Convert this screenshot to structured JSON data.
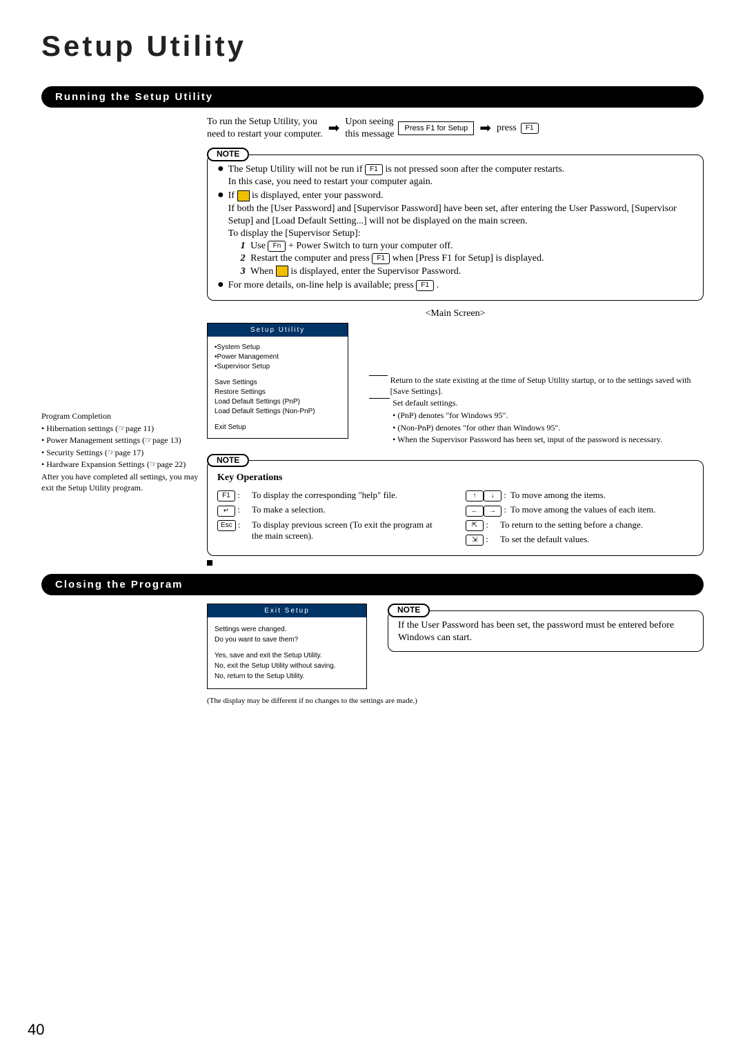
{
  "pageTitle": "Setup Utility",
  "pageNumber": "40",
  "section1": {
    "header": "Running the Setup Utility",
    "flow": {
      "text1a": "To run the Setup Utility, you",
      "text1b": "need to restart your computer.",
      "text2a": "Upon seeing",
      "text2b": "this message",
      "msgBox": "Press F1 for Setup",
      "text3": "press",
      "keyLabel": "F1"
    },
    "note1": {
      "label": "NOTE",
      "b1a": "The Setup Utility will not be run if ",
      "b1b": " is not pressed soon after the computer restarts.",
      "b1c": "In this case, you need to restart your computer again.",
      "f1": "F1",
      "b2a": "If ",
      "b2b": " is displayed, enter your password.",
      "b2c": "If both the [User Password] and [Supervisor Password] have been set, after entering the User Password, [Supervisor Setup] and [Load Default Setting...] will not be displayed on the main screen.",
      "b2d": "To display the [Supervisor Setup]:",
      "s1n": "1",
      "s1": "Use ",
      "s1k": "Fn",
      "s1b": " + Power Switch to turn your computer off.",
      "s2n": "2",
      "s2": "Restart the computer and press ",
      "s2k": "F1",
      "s2b": " when [Press F1 for Setup] is displayed.",
      "s3n": "3",
      "s3": "When ",
      "s3b": " is displayed, enter the Supervisor Password.",
      "b3a": "For more details, on-line help is available; press ",
      "b3k": "F1",
      "b3b": "."
    },
    "mainScreenLabel": "<Main Screen>",
    "screen": {
      "title": "Setup Utility",
      "items1": [
        "•System Setup",
        "•Power Management",
        "•Supervisor Setup"
      ],
      "items2": [
        "Save Settings",
        "Restore Settings",
        "Load Default Settings (PnP)",
        "Load Default Settings (Non-PnP)"
      ],
      "items3": [
        "Exit Setup"
      ]
    },
    "annotations": {
      "a1": "Return to the state existing at the time of Setup Utility startup, or to the settings saved with [Save Settings].",
      "a2": "Set default settings.",
      "a3": "• (PnP) denotes \"for Windows 95\".",
      "a4": "• (Non-PnP) denotes \"for other than Windows 95\".",
      "a5": "• When the Supervisor Password has been set, input of the password is necessary."
    },
    "sidebar": {
      "title": "Program Completion",
      "l1": "• Hibernation settings (",
      "p1": "page 11)",
      "l2": "• Power Management settings (",
      "p2": "page 13)",
      "l3": "• Security Settings (",
      "p3": "page 17)",
      "l4": "• Hardware Expansion Settings (",
      "p4": "page 22)",
      "l5": "After you have completed all settings, you may exit the Setup Utility program."
    },
    "note2": {
      "label": "NOTE",
      "title": "Key Operations",
      "k1": "F1",
      "d1": "To display the corresponding \"help\" file.",
      "k2": "Enter",
      "d2": "To make a selection.",
      "k3": "Esc",
      "d3": "To display previous screen (To exit the program at the main screen).",
      "k4a": "↑",
      "k4b": "↓",
      "d4": "To move among the items.",
      "k5a": "←",
      "k5b": "→",
      "d5": "To move among the values of each item.",
      "k6": "Home",
      "d6": "To return to the setting before a change.",
      "k7": "End",
      "d7": "To set the default values."
    }
  },
  "section2": {
    "header": "Closing the Program",
    "exit": {
      "title": "Exit Setup",
      "q1": "Settings were changed.",
      "q2": "Do you want to save them?",
      "o1": "Yes, save and exit the Setup Utility.",
      "o2": "No, exit the Setup Utility without saving.",
      "o3": "No, return to the Setup Utility."
    },
    "note": {
      "label": "NOTE",
      "text": "If the User Password has been set, the password must be entered before Windows can start."
    },
    "footnote": "(The display may be different if no changes to the settings are made.)"
  }
}
